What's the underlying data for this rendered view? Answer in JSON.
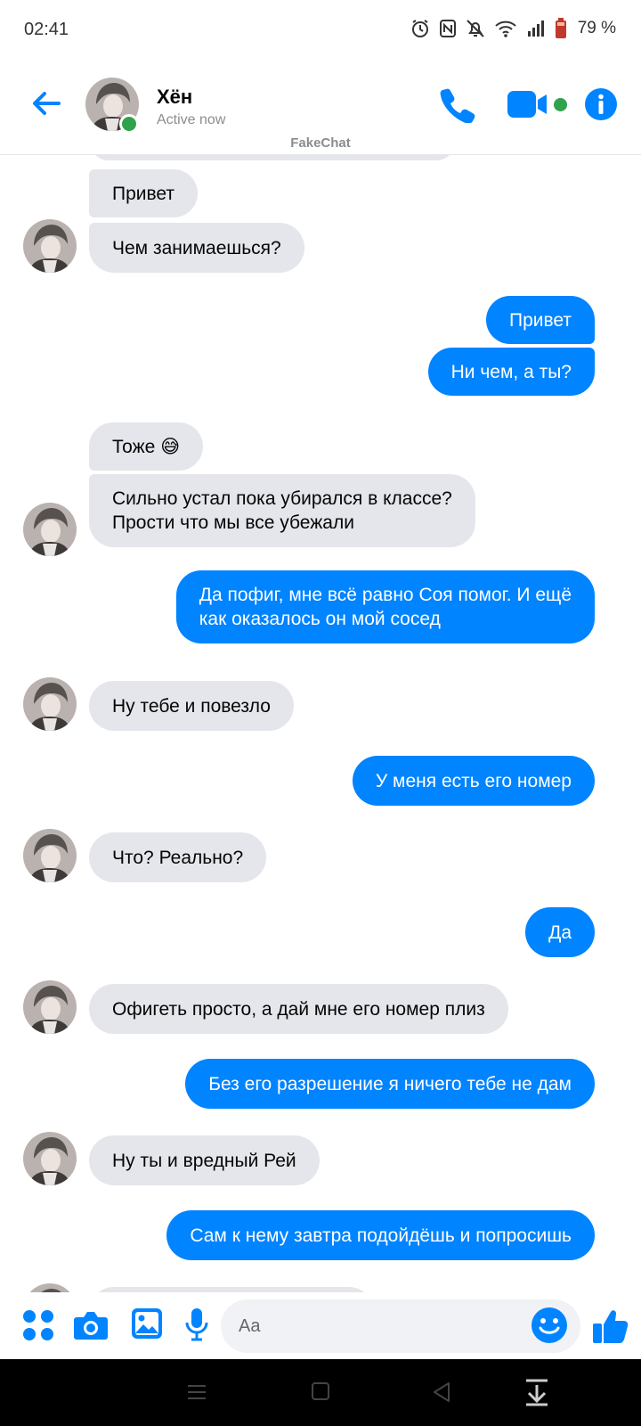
{
  "status_bar": {
    "time": "02:41",
    "battery": "79 %"
  },
  "header": {
    "contact_name": "Хён",
    "contact_status": "Active now",
    "watermark": "FakeChat"
  },
  "messages": [
    {
      "dir": "in",
      "text": "Привет"
    },
    {
      "dir": "in",
      "text": "Чем занимаешься?"
    },
    {
      "dir": "out",
      "text": "Привет"
    },
    {
      "dir": "out",
      "text": "Ни чем, а ты?"
    },
    {
      "dir": "in",
      "text": "Тоже 😅"
    },
    {
      "dir": "in",
      "text": "Сильно устал пока убирался в классе?\nПрости что мы все убежали"
    },
    {
      "dir": "out",
      "text": "Да пофиг, мне всё равно Соя помог. И ещё\nкак оказалось он мой сосед"
    },
    {
      "dir": "in",
      "text": "Ну тебе и повезло"
    },
    {
      "dir": "out",
      "text": "У меня есть его номер"
    },
    {
      "dir": "in",
      "text": "Что? Реально?"
    },
    {
      "dir": "out",
      "text": "Да"
    },
    {
      "dir": "in",
      "text": "Офигеть просто, а дай мне его номер плиз"
    },
    {
      "dir": "out",
      "text": "Без его разрешение я ничего тебе не дам"
    },
    {
      "dir": "in",
      "text": "Ну ты и вредный Рей"
    },
    {
      "dir": "out",
      "text": "Сам к нему завтра подойдёшь  и попросишь"
    }
  ],
  "composer": {
    "placeholder": "Aa"
  },
  "colors": {
    "accent": "#0084ff",
    "incoming_bubble": "#e4e6eb",
    "online": "#31a24c"
  }
}
